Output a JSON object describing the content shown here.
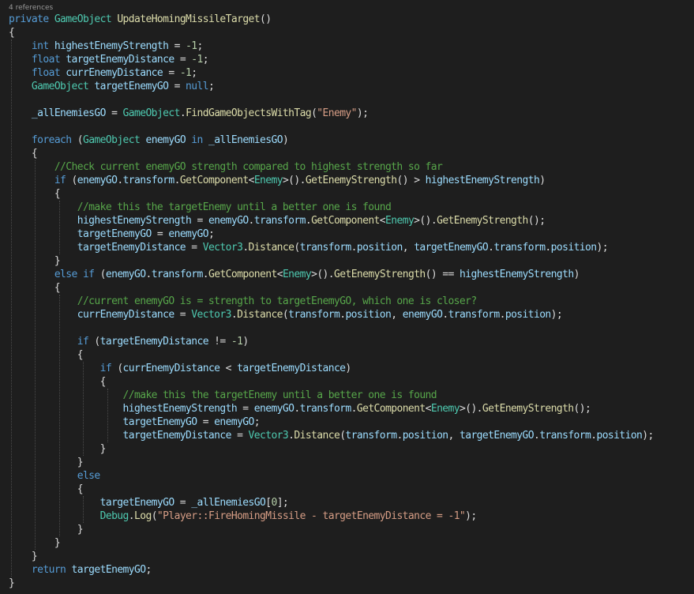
{
  "code_lens": {
    "references": "4 references"
  },
  "colors": {
    "background": "#1e1e1e",
    "keyword": "#569cd6",
    "type": "#4ec9b0",
    "method": "#dcdcaa",
    "identifier": "#9cdcfe",
    "number": "#b5cea8",
    "string": "#d69d85",
    "comment": "#57a64a",
    "plain": "#dcdcdc"
  },
  "code_lines": [
    [
      [
        "kw",
        "private "
      ],
      [
        "ty",
        "GameObject "
      ],
      [
        "fn",
        "UpdateHomingMissileTarget"
      ],
      [
        "pl",
        "()"
      ]
    ],
    [
      [
        "pl",
        "{"
      ]
    ],
    [
      [
        "kw",
        "    int "
      ],
      [
        "va",
        "highestEnemyStrength"
      ],
      [
        "pl",
        " = "
      ],
      [
        "nu",
        "-1"
      ],
      [
        "pl",
        ";"
      ]
    ],
    [
      [
        "kw",
        "    float "
      ],
      [
        "va",
        "targetEnemyDistance"
      ],
      [
        "pl",
        " = "
      ],
      [
        "nu",
        "-1"
      ],
      [
        "pl",
        ";"
      ]
    ],
    [
      [
        "kw",
        "    float "
      ],
      [
        "va",
        "currEnemyDistance"
      ],
      [
        "pl",
        " = "
      ],
      [
        "nu",
        "-1"
      ],
      [
        "pl",
        ";"
      ]
    ],
    [
      [
        "ty",
        "    GameObject "
      ],
      [
        "va",
        "targetEnemyGO"
      ],
      [
        "pl",
        " = "
      ],
      [
        "kw",
        "null"
      ],
      [
        "pl",
        ";"
      ]
    ],
    [],
    [
      [
        "va",
        "    _allEnemiesGO"
      ],
      [
        "pl",
        " = "
      ],
      [
        "ty",
        "GameObject"
      ],
      [
        "pl",
        "."
      ],
      [
        "fn",
        "FindGameObjectsWithTag"
      ],
      [
        "pl",
        "("
      ],
      [
        "st",
        "\"Enemy\""
      ],
      [
        "pl",
        ");"
      ]
    ],
    [],
    [
      [
        "kw",
        "    foreach "
      ],
      [
        "pl",
        "("
      ],
      [
        "ty",
        "GameObject "
      ],
      [
        "va",
        "enemyGO "
      ],
      [
        "kw",
        "in "
      ],
      [
        "va",
        "_allEnemiesGO"
      ],
      [
        "pl",
        ")"
      ]
    ],
    [
      [
        "pl",
        "    {"
      ]
    ],
    [
      [
        "cm",
        "        //Check current enemyGO strength compared to highest strength so far"
      ]
    ],
    [
      [
        "kw",
        "        if "
      ],
      [
        "pl",
        "("
      ],
      [
        "va",
        "enemyGO"
      ],
      [
        "pl",
        "."
      ],
      [
        "va",
        "transform"
      ],
      [
        "pl",
        "."
      ],
      [
        "fn",
        "GetComponent"
      ],
      [
        "pl",
        "<"
      ],
      [
        "ty",
        "Enemy"
      ],
      [
        "pl",
        ">()."
      ],
      [
        "fn",
        "GetEnemyStrength"
      ],
      [
        "pl",
        "() > "
      ],
      [
        "va",
        "highestEnemyStrength"
      ],
      [
        "pl",
        ")"
      ]
    ],
    [
      [
        "pl",
        "        {"
      ]
    ],
    [
      [
        "cm",
        "            //make this the targetEnemy until a better one is found"
      ]
    ],
    [
      [
        "va",
        "            highestEnemyStrength"
      ],
      [
        "pl",
        " = "
      ],
      [
        "va",
        "enemyGO"
      ],
      [
        "pl",
        "."
      ],
      [
        "va",
        "transform"
      ],
      [
        "pl",
        "."
      ],
      [
        "fn",
        "GetComponent"
      ],
      [
        "pl",
        "<"
      ],
      [
        "ty",
        "Enemy"
      ],
      [
        "pl",
        ">()."
      ],
      [
        "fn",
        "GetEnemyStrength"
      ],
      [
        "pl",
        "();"
      ]
    ],
    [
      [
        "va",
        "            targetEnemyGO"
      ],
      [
        "pl",
        " = "
      ],
      [
        "va",
        "enemyGO"
      ],
      [
        "pl",
        ";"
      ]
    ],
    [
      [
        "va",
        "            targetEnemyDistance"
      ],
      [
        "pl",
        " = "
      ],
      [
        "ty",
        "Vector3"
      ],
      [
        "pl",
        "."
      ],
      [
        "fn",
        "Distance"
      ],
      [
        "pl",
        "("
      ],
      [
        "va",
        "transform"
      ],
      [
        "pl",
        "."
      ],
      [
        "va",
        "position"
      ],
      [
        "pl",
        ", "
      ],
      [
        "va",
        "targetEnemyGO"
      ],
      [
        "pl",
        "."
      ],
      [
        "va",
        "transform"
      ],
      [
        "pl",
        "."
      ],
      [
        "va",
        "position"
      ],
      [
        "pl",
        ");"
      ]
    ],
    [
      [
        "pl",
        "        }"
      ]
    ],
    [
      [
        "kw",
        "        else if "
      ],
      [
        "pl",
        "("
      ],
      [
        "va",
        "enemyGO"
      ],
      [
        "pl",
        "."
      ],
      [
        "va",
        "transform"
      ],
      [
        "pl",
        "."
      ],
      [
        "fn",
        "GetComponent"
      ],
      [
        "pl",
        "<"
      ],
      [
        "ty",
        "Enemy"
      ],
      [
        "pl",
        ">()."
      ],
      [
        "fn",
        "GetEnemyStrength"
      ],
      [
        "pl",
        "() == "
      ],
      [
        "va",
        "highestEnemyStrength"
      ],
      [
        "pl",
        ")"
      ]
    ],
    [
      [
        "pl",
        "        {"
      ]
    ],
    [
      [
        "cm",
        "            //current enemyGO is = strength to targetEnemyGO, which one is closer?"
      ]
    ],
    [
      [
        "va",
        "            currEnemyDistance"
      ],
      [
        "pl",
        " = "
      ],
      [
        "ty",
        "Vector3"
      ],
      [
        "pl",
        "."
      ],
      [
        "fn",
        "Distance"
      ],
      [
        "pl",
        "("
      ],
      [
        "va",
        "transform"
      ],
      [
        "pl",
        "."
      ],
      [
        "va",
        "position"
      ],
      [
        "pl",
        ", "
      ],
      [
        "va",
        "enemyGO"
      ],
      [
        "pl",
        "."
      ],
      [
        "va",
        "transform"
      ],
      [
        "pl",
        "."
      ],
      [
        "va",
        "position"
      ],
      [
        "pl",
        ");"
      ]
    ],
    [],
    [
      [
        "kw",
        "            if "
      ],
      [
        "pl",
        "("
      ],
      [
        "va",
        "targetEnemyDistance"
      ],
      [
        "pl",
        " != "
      ],
      [
        "nu",
        "-1"
      ],
      [
        "pl",
        ")"
      ]
    ],
    [
      [
        "pl",
        "            {"
      ]
    ],
    [
      [
        "kw",
        "                if "
      ],
      [
        "pl",
        "("
      ],
      [
        "va",
        "currEnemyDistance"
      ],
      [
        "pl",
        " < "
      ],
      [
        "va",
        "targetEnemyDistance"
      ],
      [
        "pl",
        ")"
      ]
    ],
    [
      [
        "pl",
        "                {"
      ]
    ],
    [
      [
        "cm",
        "                    //make this the targetEnemy until a better one is found"
      ]
    ],
    [
      [
        "va",
        "                    highestEnemyStrength"
      ],
      [
        "pl",
        " = "
      ],
      [
        "va",
        "enemyGO"
      ],
      [
        "pl",
        "."
      ],
      [
        "va",
        "transform"
      ],
      [
        "pl",
        "."
      ],
      [
        "fn",
        "GetComponent"
      ],
      [
        "pl",
        "<"
      ],
      [
        "ty",
        "Enemy"
      ],
      [
        "pl",
        ">()."
      ],
      [
        "fn",
        "GetEnemyStrength"
      ],
      [
        "pl",
        "();"
      ]
    ],
    [
      [
        "va",
        "                    targetEnemyGO"
      ],
      [
        "pl",
        " = "
      ],
      [
        "va",
        "enemyGO"
      ],
      [
        "pl",
        ";"
      ]
    ],
    [
      [
        "va",
        "                    targetEnemyDistance"
      ],
      [
        "pl",
        " = "
      ],
      [
        "ty",
        "Vector3"
      ],
      [
        "pl",
        "."
      ],
      [
        "fn",
        "Distance"
      ],
      [
        "pl",
        "("
      ],
      [
        "va",
        "transform"
      ],
      [
        "pl",
        "."
      ],
      [
        "va",
        "position"
      ],
      [
        "pl",
        ", "
      ],
      [
        "va",
        "targetEnemyGO"
      ],
      [
        "pl",
        "."
      ],
      [
        "va",
        "transform"
      ],
      [
        "pl",
        "."
      ],
      [
        "va",
        "position"
      ],
      [
        "pl",
        ");"
      ]
    ],
    [
      [
        "pl",
        "                }"
      ]
    ],
    [
      [
        "pl",
        "            }"
      ]
    ],
    [
      [
        "kw",
        "            else"
      ]
    ],
    [
      [
        "pl",
        "            {"
      ]
    ],
    [
      [
        "va",
        "                targetEnemyGO"
      ],
      [
        "pl",
        " = "
      ],
      [
        "va",
        "_allEnemiesGO"
      ],
      [
        "pl",
        "["
      ],
      [
        "nu",
        "0"
      ],
      [
        "pl",
        "];"
      ]
    ],
    [
      [
        "ty",
        "                Debug"
      ],
      [
        "pl",
        "."
      ],
      [
        "fn",
        "Log"
      ],
      [
        "pl",
        "("
      ],
      [
        "st",
        "\"Player::FireHomingMissile - targetEnemyDistance = -1\""
      ],
      [
        "pl",
        ");"
      ]
    ],
    [
      [
        "pl",
        "            }"
      ]
    ],
    [
      [
        "pl",
        "        }"
      ]
    ],
    [
      [
        "pl",
        "    }"
      ]
    ],
    [
      [
        "kw",
        "    return "
      ],
      [
        "va",
        "targetEnemyGO"
      ],
      [
        "pl",
        ";"
      ]
    ],
    [
      [
        "pl",
        "}"
      ]
    ]
  ]
}
